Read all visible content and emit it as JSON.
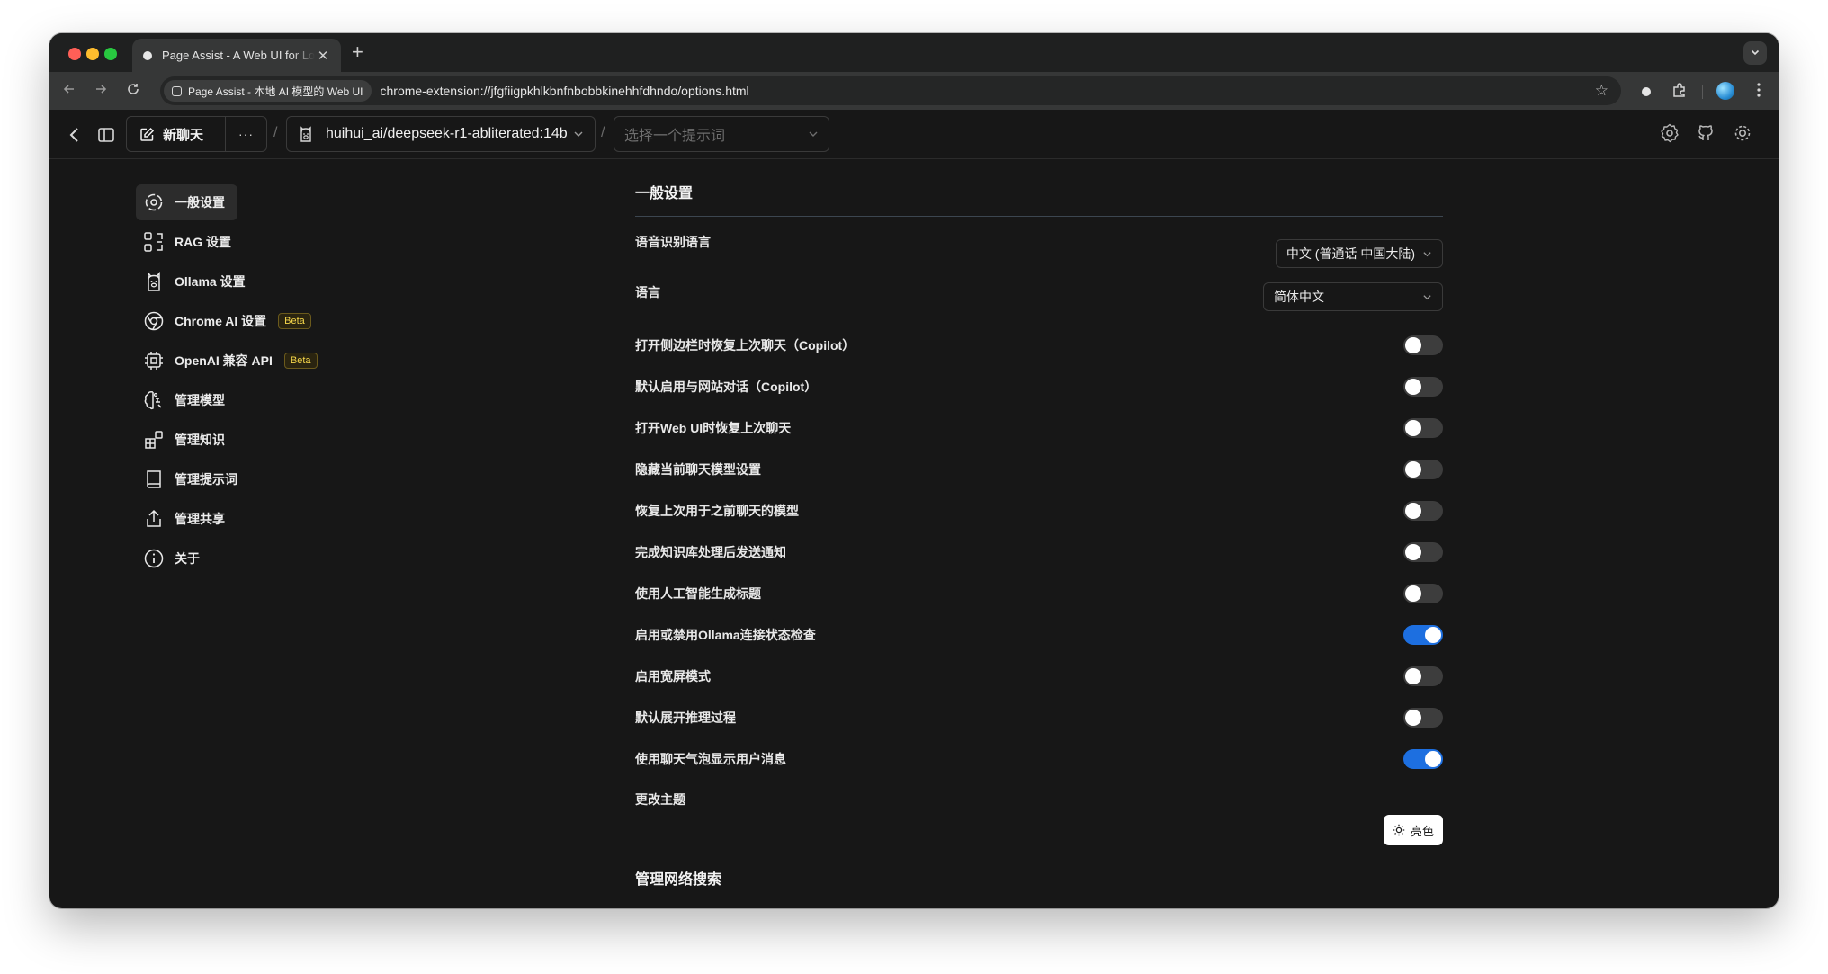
{
  "browser": {
    "tab_title": "Page Assist - A Web UI for Local AI Models",
    "tab_close": "✕",
    "new_tab": "+",
    "site_chip": "Page Assist - 本地 AI 模型的 Web UI",
    "url": "chrome-extension://jfgfiigpkhlkbnfnbobbkinehhfdhndo/options.html"
  },
  "header": {
    "new_chat_label": "新聊天",
    "more_label": "···",
    "separator": "/",
    "model_name": "huihui_ai/deepseek-r1-abliterated:14b",
    "prompt_placeholder": "选择一个提示词"
  },
  "sidebar": {
    "items": [
      {
        "label": "一般设置",
        "icon": "gear-icon",
        "active": true
      },
      {
        "label": "RAG 设置",
        "icon": "rag-icon"
      },
      {
        "label": "Ollama 设置",
        "icon": "llama-icon"
      },
      {
        "label": "Chrome AI 设置",
        "icon": "chrome-icon",
        "badge": "Beta"
      },
      {
        "label": "OpenAI 兼容 API",
        "icon": "cpu-icon",
        "badge": "Beta"
      },
      {
        "label": "管理模型",
        "icon": "brain-icon"
      },
      {
        "label": "管理知识",
        "icon": "blocks-icon"
      },
      {
        "label": "管理提示词",
        "icon": "book-icon"
      },
      {
        "label": "管理共享",
        "icon": "share-icon"
      },
      {
        "label": "关于",
        "icon": "info-icon"
      }
    ]
  },
  "general": {
    "title": "一般设置",
    "speech_language_label": "语音识别语言",
    "speech_language_value": "中文 (普通话 中国大陆)",
    "language_label": "语言",
    "language_value": "简体中文",
    "toggles": [
      {
        "label": "打开侧边栏时恢复上次聊天（Copilot）",
        "on": false
      },
      {
        "label": "默认启用与网站对话（Copilot）",
        "on": false
      },
      {
        "label": "打开Web UI时恢复上次聊天",
        "on": false
      },
      {
        "label": "隐藏当前聊天模型设置",
        "on": false
      },
      {
        "label": "恢复上次用于之前聊天的模型",
        "on": false
      },
      {
        "label": "完成知识库处理后发送通知",
        "on": false
      },
      {
        "label": "使用人工智能生成标题",
        "on": false
      },
      {
        "label": "启用或禁用Ollama连接状态检查",
        "on": true
      },
      {
        "label": "启用宽屏模式",
        "on": false
      },
      {
        "label": "默认展开推理过程",
        "on": false
      },
      {
        "label": "使用聊天气泡显示用户消息",
        "on": true
      }
    ],
    "theme_label": "更改主题",
    "theme_button": "亮色"
  },
  "web_search": {
    "title": "管理网络搜索"
  },
  "colors": {
    "accent": "#1d6fe0",
    "beta_text": "#f5d64a"
  }
}
